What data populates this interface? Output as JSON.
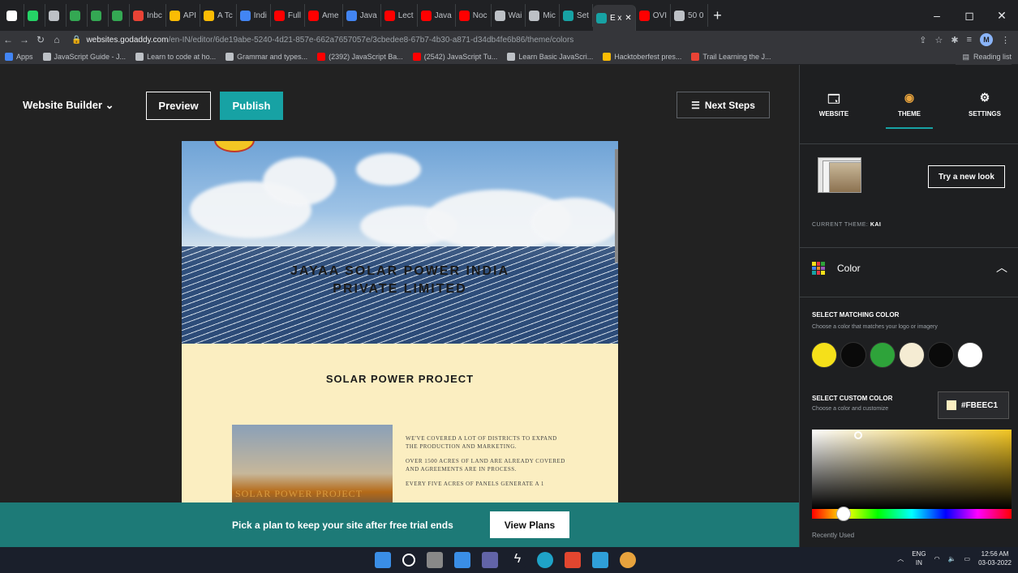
{
  "browser": {
    "tabs": [
      {
        "label": "",
        "color": "#ffffff"
      },
      {
        "label": "",
        "color": "#25d366"
      },
      {
        "label": "",
        "color": "#bdc1c6"
      },
      {
        "label": "",
        "color": "#34a853"
      },
      {
        "label": "",
        "color": "#34a853"
      },
      {
        "label": "",
        "color": "#34a853"
      },
      {
        "label": "Inbc",
        "color": "#ea4335"
      },
      {
        "label": "API",
        "color": "#fbbc04"
      },
      {
        "label": "A Tc",
        "color": "#fbbc04"
      },
      {
        "label": "Indi",
        "color": "#4285f4"
      },
      {
        "label": "Full",
        "color": "#ff0000"
      },
      {
        "label": "Ame",
        "color": "#ff0000"
      },
      {
        "label": "Java",
        "color": "#4285f4"
      },
      {
        "label": "Lect",
        "color": "#ff0000"
      },
      {
        "label": "Java",
        "color": "#ff0000"
      },
      {
        "label": "Noc",
        "color": "#ff0000"
      },
      {
        "label": "Wai",
        "color": "#bdc1c6"
      },
      {
        "label": "Mic",
        "color": "#bdc1c6"
      },
      {
        "label": "Set",
        "color": "#17a2a4"
      },
      {
        "label": "E x",
        "color": "#17a2a4",
        "active": true
      },
      {
        "label": "OVI",
        "color": "#ff0000"
      },
      {
        "label": "50 0",
        "color": "#bdc1c6"
      }
    ],
    "new_tab": "+",
    "window_controls": {
      "minimize": "–",
      "maximize": "◻",
      "close": "✕"
    },
    "url_host": "websites.godaddy.com",
    "url_path": "/en-IN/editor/6de19abe-5240-4d21-857e-662a7657057e/3cbedee8-67b7-4b30-a871-d34db4fe6b86/theme/colors",
    "profile_initial": "M",
    "bookmarks": [
      {
        "label": "Apps",
        "color": "#4285f4"
      },
      {
        "label": "JavaScript Guide - J...",
        "color": "#bdc1c6"
      },
      {
        "label": "Learn to code at ho...",
        "color": "#bdc1c6"
      },
      {
        "label": "Grammar and types...",
        "color": "#bdc1c6"
      },
      {
        "label": "(2392) JavaScript Ba...",
        "color": "#ff0000"
      },
      {
        "label": "(2542) JavaScript Tu...",
        "color": "#ff0000"
      },
      {
        "label": "Learn Basic JavaScri...",
        "color": "#bdc1c6"
      },
      {
        "label": "Hacktoberfest pres...",
        "color": "#fbbc04"
      },
      {
        "label": "Trail Learning the J...",
        "color": "#ea4335"
      }
    ],
    "reading_list": "Reading list"
  },
  "editor": {
    "brand": "Website Builder",
    "preview_btn": "Preview",
    "publish_btn": "Publish",
    "next_steps_btn": "Next Steps",
    "site": {
      "hero_line1": "JAYAA SOLAR POWER INDIA",
      "hero_line2": "PRIVATE LIMITED",
      "section_title": "SOLAR POWER PROJECT",
      "image_caption": "SOLAR POWER PROJECT",
      "paragraphs": [
        "WE'VE COVERED A LOT OF DISTRICTS TO EXPAND THE PRODUCTION AND MARKETING.",
        "OVER 1500 ACRES OF LAND ARE ALREADY COVERED AND AGREEMENTS ARE IN PROCESS.",
        "EVERY FIVE ACRES OF PANELS GENERATE A 1"
      ]
    },
    "banner": {
      "text": "Pick a plan to keep your site after free trial ends",
      "button": "View Plans"
    }
  },
  "sidebar": {
    "tabs": [
      {
        "label": "WEBSITE",
        "icon": "website-icon"
      },
      {
        "label": "THEME",
        "icon": "palette-icon",
        "active": true
      },
      {
        "label": "SETTINGS",
        "icon": "gear-icon"
      }
    ],
    "try_new_look": "Try a new look",
    "current_theme_label": "CURRENT THEME:",
    "current_theme_value": "KAI",
    "color_section": "Color",
    "select_matching_title": "SELECT MATCHING COLOR",
    "select_matching_sub": "Choose a color that matches your logo or imagery",
    "swatches": [
      "#f5e01a",
      "#0a0a0a",
      "#2ea33a",
      "#f5ecd3",
      "#0a0a0a",
      "#ffffff"
    ],
    "select_custom_title": "SELECT CUSTOM COLOR",
    "select_custom_sub": "Choose a color and customize",
    "hex_value": "#FBEEC1",
    "recently_used": "Recently Used"
  },
  "taskbar": {
    "lang": "ENG",
    "region": "IN",
    "time": "12:56 AM",
    "date": "03-03-2022"
  }
}
